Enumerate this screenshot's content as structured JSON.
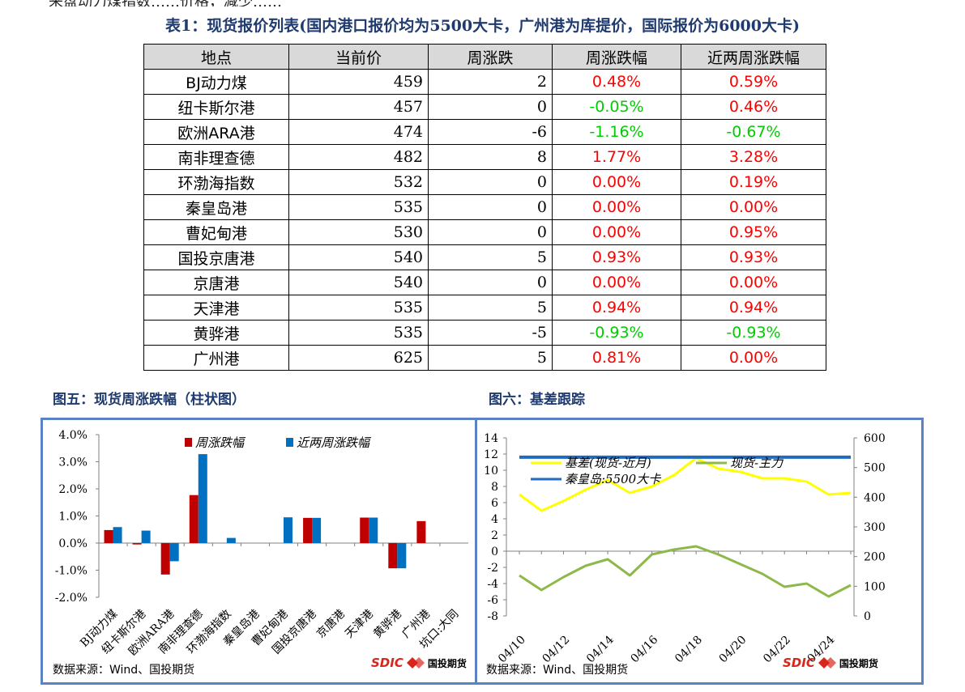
{
  "top_fragment": "来盘动力煤指数……价格，减少……",
  "table": {
    "title": "表1：现货报价列表(国内港口报价均为5500大卡，广州港为库提价，国际报价为6000大卡)",
    "headers": [
      "地点",
      "当前价",
      "周涨跌",
      "周涨跌幅",
      "近两周涨跌幅"
    ],
    "rows": [
      {
        "place": "BJ动力煤",
        "price": "459",
        "wk_chg": "2",
        "wk_pct": "0.48%",
        "two_wk_pct": "0.59%"
      },
      {
        "place": "纽卡斯尔港",
        "price": "457",
        "wk_chg": "0",
        "wk_pct": "-0.05%",
        "two_wk_pct": "0.46%"
      },
      {
        "place": "欧洲ARA港",
        "price": "474",
        "wk_chg": "-6",
        "wk_pct": "-1.16%",
        "two_wk_pct": "-0.67%"
      },
      {
        "place": "南非理查德",
        "price": "482",
        "wk_chg": "8",
        "wk_pct": "1.77%",
        "two_wk_pct": "3.28%"
      },
      {
        "place": "环渤海指数",
        "price": "532",
        "wk_chg": "0",
        "wk_pct": "0.00%",
        "two_wk_pct": "0.19%"
      },
      {
        "place": "秦皇岛港",
        "price": "535",
        "wk_chg": "0",
        "wk_pct": "0.00%",
        "two_wk_pct": "0.00%"
      },
      {
        "place": "曹妃甸港",
        "price": "530",
        "wk_chg": "0",
        "wk_pct": "0.00%",
        "two_wk_pct": "0.95%"
      },
      {
        "place": "国投京唐港",
        "price": "540",
        "wk_chg": "5",
        "wk_pct": "0.93%",
        "two_wk_pct": "0.93%"
      },
      {
        "place": "京唐港",
        "price": "540",
        "wk_chg": "0",
        "wk_pct": "0.00%",
        "two_wk_pct": "0.00%"
      },
      {
        "place": "天津港",
        "price": "535",
        "wk_chg": "5",
        "wk_pct": "0.94%",
        "two_wk_pct": "0.94%"
      },
      {
        "place": "黄骅港",
        "price": "535",
        "wk_chg": "-5",
        "wk_pct": "-0.93%",
        "two_wk_pct": "-0.93%"
      },
      {
        "place": "广州港",
        "price": "625",
        "wk_chg": "5",
        "wk_pct": "0.81%",
        "two_wk_pct": "0.00%"
      }
    ]
  },
  "colors": {
    "up": "#ff0000",
    "down": "#00cc00",
    "title_blue": "#1f3a6e",
    "rule": "#5b83c4",
    "bar_red": "#c00000",
    "bar_blue": "#0070c0",
    "yellow": "#ffff00",
    "navy": "#1f6bbf",
    "green": "#8db84a"
  },
  "fig5": {
    "title": "图五：现货周涨跌幅（柱状图）",
    "source": "数据来源：Wind、国投期货"
  },
  "fig6": {
    "title": "图六：基差跟踪",
    "source": "数据来源：Wind、国投期货"
  },
  "logo": {
    "brand": "SDIC",
    "name": "国投期货"
  },
  "chart_data": [
    {
      "type": "bar",
      "categories": [
        "BJ动力煤",
        "纽卡斯尔港",
        "欧洲ARA港",
        "南非理查德",
        "环渤海指数",
        "秦皇岛港",
        "曹妃甸港",
        "国投京唐港",
        "京唐港",
        "天津港",
        "黄骅港",
        "广州港",
        "坑口:大同"
      ],
      "series": [
        {
          "name": "周涨跌幅",
          "values": [
            0.48,
            -0.05,
            -1.16,
            1.77,
            0.0,
            0.0,
            0.0,
            0.93,
            0.0,
            0.94,
            -0.93,
            0.81,
            0.0
          ]
        },
        {
          "name": "近两周涨跌幅",
          "values": [
            0.59,
            0.46,
            -0.67,
            3.28,
            0.19,
            0.0,
            0.95,
            0.93,
            0.0,
            0.94,
            -0.93,
            0.0,
            0.0
          ]
        }
      ],
      "ylim": [
        -2.0,
        4.0
      ],
      "yticks": [
        "-2.0%",
        "-1.0%",
        "0.0%",
        "1.0%",
        "2.0%",
        "3.0%",
        "4.0%"
      ],
      "legend": "top"
    },
    {
      "type": "line",
      "x": [
        "04/10",
        "04/11",
        "04/12",
        "04/13",
        "04/14",
        "04/15",
        "04/16",
        "04/17",
        "04/18",
        "04/19",
        "04/20",
        "04/21",
        "04/22",
        "04/23",
        "04/24",
        "04/25"
      ],
      "xticks": [
        "04/10",
        "04/12",
        "04/14",
        "04/16",
        "04/18",
        "04/20",
        "04/22",
        "04/24"
      ],
      "series": [
        {
          "name": "基差(现货-近月)",
          "axis": "left",
          "values": [
            7,
            5,
            6.2,
            7.6,
            8.8,
            7.2,
            8,
            9.4,
            11.5,
            10.2,
            9.8,
            9,
            9,
            8.6,
            7,
            7.2
          ]
        },
        {
          "name": "现货-主力",
          "axis": "left",
          "values": [
            -3,
            -4.8,
            -3.2,
            -1.8,
            -1,
            -3,
            -0.4,
            0.2,
            0.6,
            -0.4,
            -1.6,
            -2.8,
            -4.4,
            -4,
            -5.6,
            -4.2
          ]
        },
        {
          "name": "秦皇岛:5500大卡",
          "axis": "right",
          "values": [
            535,
            535,
            535,
            535,
            535,
            535,
            535,
            535,
            535,
            535,
            535,
            535,
            535,
            535,
            535,
            535
          ]
        }
      ],
      "ylim_left": [
        -8,
        14
      ],
      "yticks_left": [
        "-8",
        "-6",
        "-4",
        "-2",
        "0",
        "2",
        "4",
        "6",
        "8",
        "10",
        "12",
        "14"
      ],
      "ylim_right": [
        0,
        600
      ],
      "yticks_right": [
        "0",
        "100",
        "200",
        "300",
        "400",
        "500",
        "600"
      ],
      "legend": "top-left"
    }
  ]
}
